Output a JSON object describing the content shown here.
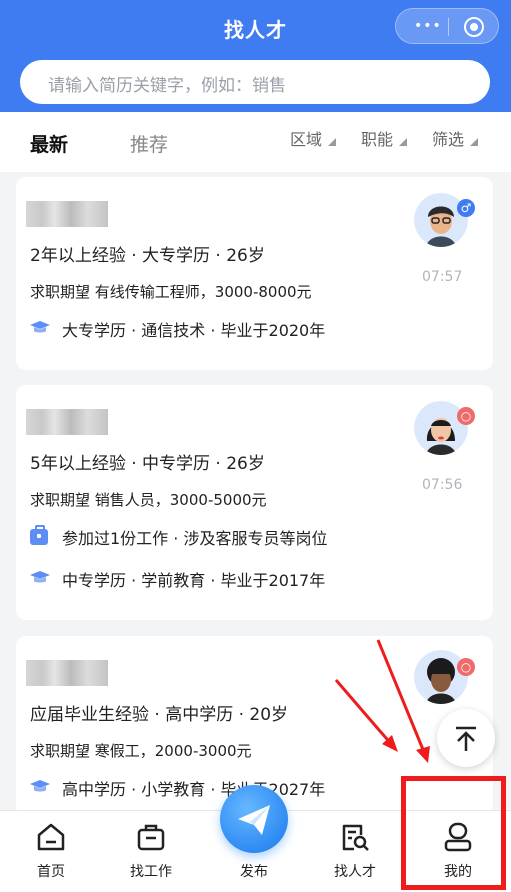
{
  "header": {
    "title": "找人才"
  },
  "search": {
    "placeholder": "请输入简历关键字，例如：销售"
  },
  "tabs": {
    "latest": "最新",
    "recommend": "推荐"
  },
  "filters": {
    "region": "区域",
    "position": "职能",
    "filter": "筛选"
  },
  "cards": [
    {
      "line1": "2年以上经验 · 大专学历 · 26岁",
      "line2": "求职期望 有线传输工程师，3000-8000元",
      "info": [
        {
          "icon": "graduation-cap-icon",
          "text": "大专学历 · 通信技术 · 毕业于2020年"
        }
      ],
      "time": "07:57",
      "gender": "male"
    },
    {
      "line1": "5年以上经验 · 中专学历 · 26岁",
      "line2": "求职期望 销售人员，3000-5000元",
      "info": [
        {
          "icon": "briefcase-icon",
          "text": "参加过1份工作 · 涉及客服专员等岗位"
        },
        {
          "icon": "graduation-cap-icon",
          "text": "中专学历 · 学前教育 · 毕业于2017年"
        }
      ],
      "time": "07:56",
      "gender": "female"
    },
    {
      "line1": "应届毕业生经验 · 高中学历 · 20岁",
      "line2": "求职期望 寒假工，2000-3000元",
      "info": [
        {
          "icon": "graduation-cap-icon",
          "text": "高中学历 · 小学教育 · 毕业于2027年"
        }
      ],
      "gender": "female"
    }
  ],
  "tabbar": {
    "home": "首页",
    "find_job": "找工作",
    "publish": "发布",
    "find_talent": "找人才",
    "mine": "我的"
  },
  "colors": {
    "brand": "#3f7cf2",
    "annotation": "#ef1c1c"
  }
}
